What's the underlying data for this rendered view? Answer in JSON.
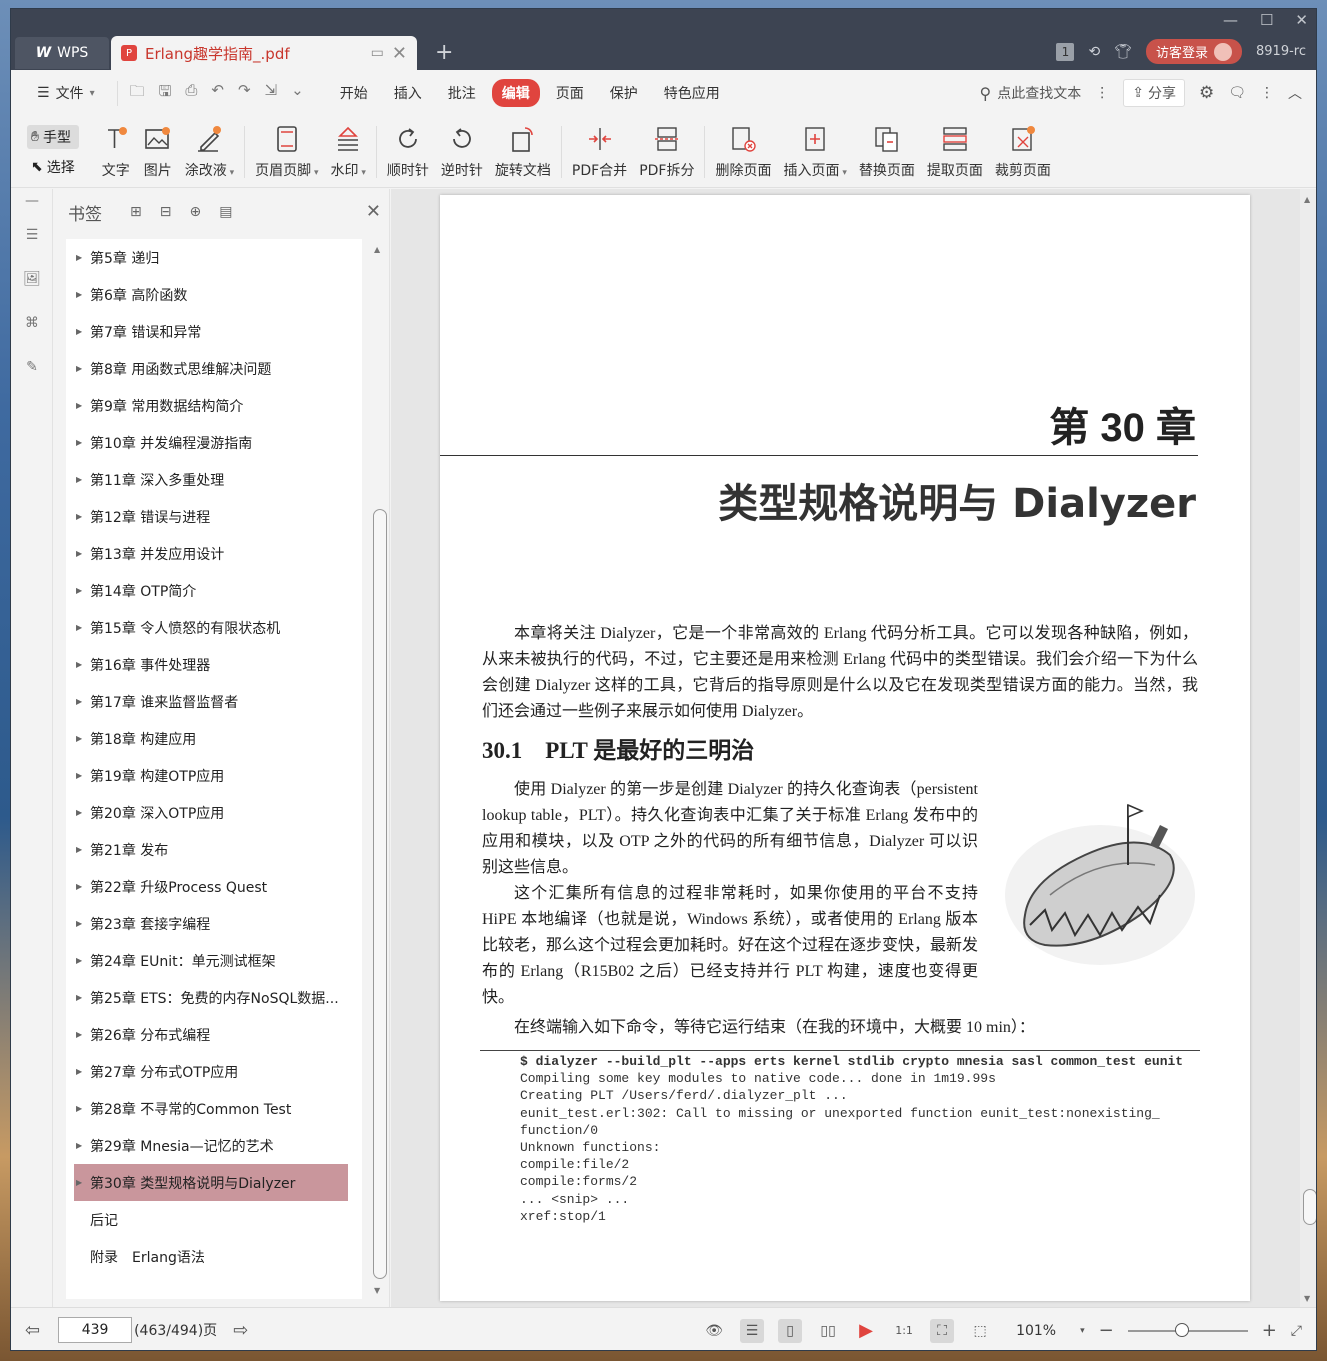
{
  "titlebar": {
    "app_tab": "WPS",
    "doc_tab": "Erlang趣学指南_.pdf",
    "page_badge": "1",
    "login": "访客登录",
    "version": "8919-rc"
  },
  "menubar": {
    "file": "文件",
    "items": [
      "开始",
      "插入",
      "批注",
      "编辑",
      "页面",
      "保护",
      "特色应用"
    ],
    "active": "编辑",
    "search": "点此查找文本",
    "share": "分享"
  },
  "toolbar": {
    "hand": "手型",
    "select": "选择",
    "tools": [
      "文字",
      "图片",
      "涂改液",
      "页眉页脚",
      "水印",
      "顺时针",
      "逆时针",
      "旋转文档",
      "PDF合并",
      "PDF拆分",
      "删除页面",
      "插入页面",
      "替换页面",
      "提取页面",
      "裁剪页面"
    ]
  },
  "bookmarks": {
    "title": "书签",
    "items": [
      "第5章 递归",
      "第6章 高阶函数",
      "第7章 错误和异常",
      "第8章 用函数式思维解决问题",
      "第9章 常用数据结构简介",
      "第10章 并发编程漫游指南",
      "第11章 深入多重处理",
      "第12章 错误与进程",
      "第13章 并发应用设计",
      "第14章 OTP简介",
      "第15章 令人愤怒的有限状态机",
      "第16章 事件处理器",
      "第17章 谁来监督监督者",
      "第18章 构建应用",
      "第19章 构建OTP应用",
      "第20章 深入OTP应用",
      "第21章 发布",
      "第22章 升级Process Quest",
      "第23章 套接字编程",
      "第24章 EUnit：单元测试框架",
      "第25章 ETS：免费的内存NoSQL数据...",
      "第26章 分布式编程",
      "第27章 分布式OTP应用",
      "第28章 不寻常的Common Test",
      "第29章 Mnesia—记忆的艺术",
      "第30章 类型规格说明与Dialyzer"
    ],
    "plain_items": [
      "后记",
      "附录　Erlang语法"
    ]
  },
  "page": {
    "chapter_number": "第 30 章",
    "chapter_title": "类型规格说明与 Dialyzer",
    "intro": "本章将关注 Dialyzer，它是一个非常高效的 Erlang 代码分析工具。它可以发现各种缺陷，例如，从来未被执行的代码，不过，它主要还是用来检测 Erlang 代码中的类型错误。我们会介绍一下为什么会创建 Dialyzer 这样的工具，它背后的指导原则是什么以及它在发现类型错误方面的能力。当然，我们还会通过一些例子来展示如何使用 Dialyzer。",
    "section_title": "30.1　PLT 是最好的三明治",
    "p1": "使用 Dialyzer 的第一步是创建 Dialyzer 的持久化查询表（persistent lookup table，PLT）。持久化查询表中汇集了关于标准 Erlang 发布中的应用和模块，以及 OTP 之外的代码的所有细节信息，Dialyzer 可以识别这些信息。",
    "p2": "这个汇集所有信息的过程非常耗时，如果你使用的平台不支持 HiPE 本地编译（也就是说，Windows 系统），或者使用的 Erlang 版本比较老，那么这个过程会更加耗时。好在这个过程在逐步变快，最新发布的 Erlang（R15B02 之后）已经支持并行 PLT 构建，速度也变得更快。",
    "p3": "在终端输入如下命令，等待它运行结束（在我的环境中，大概要 10 min）：",
    "code": [
      "$ dialyzer --build_plt --apps erts kernel stdlib crypto mnesia sasl common_test eunit",
      "Compiling some key modules to native code... done in 1m19.99s",
      "Creating PLT /Users/ferd/.dialyzer_plt ...",
      "eunit_test.erl:302: Call to missing or unexported function eunit_test:nonexisting_",
      "function/0",
      "Unknown functions:",
      "compile:file/2",
      "compile:forms/2",
      "... <snip> ...",
      "xref:stop/1"
    ]
  },
  "status": {
    "page_input": "439",
    "page_total": "(463/494)页",
    "zoom": "101%"
  },
  "colors": {
    "accent": "#e0443e",
    "selected_bookmark": "#c9969c",
    "titlebar": "#3d4452"
  }
}
